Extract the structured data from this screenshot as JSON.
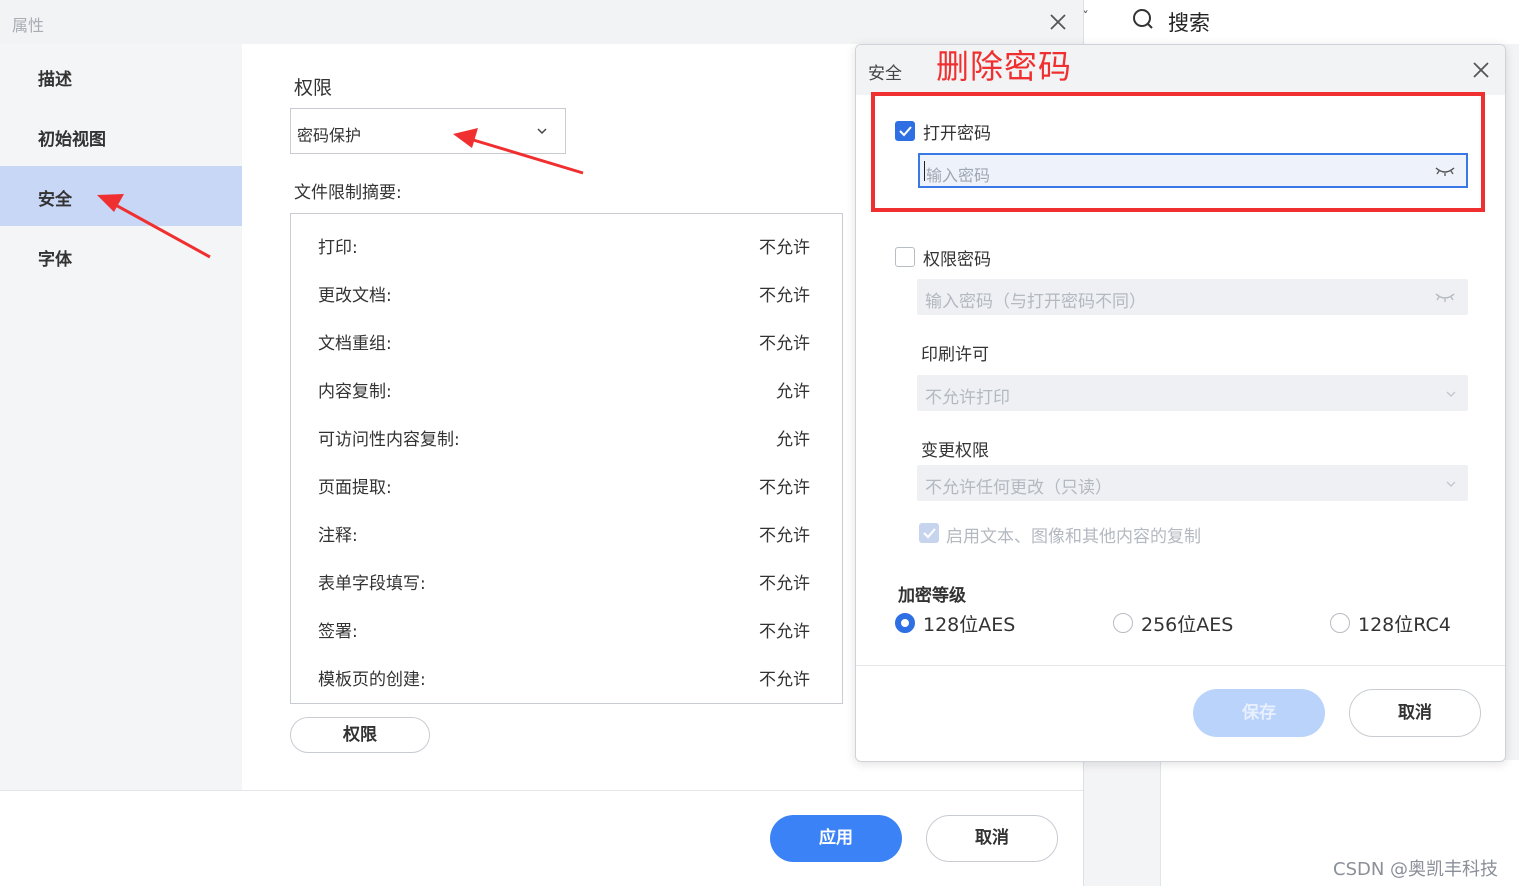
{
  "background_app": {
    "search_label": "搜索"
  },
  "properties_dialog": {
    "title": "属性",
    "sidebar": [
      {
        "label": "描述",
        "active": false
      },
      {
        "label": "初始视图",
        "active": false
      },
      {
        "label": "安全",
        "active": true
      },
      {
        "label": "字体",
        "active": false
      }
    ],
    "permission_heading": "权限",
    "permission_select_value": "密码保护",
    "summary_label": "文件限制摘要:",
    "summary_rows": [
      {
        "key": "打印:",
        "value": "不允许"
      },
      {
        "key": "更改文档:",
        "value": "不允许"
      },
      {
        "key": "文档重组:",
        "value": "不允许"
      },
      {
        "key": "内容复制:",
        "value": "允许"
      },
      {
        "key": "可访问性内容复制:",
        "value": "允许"
      },
      {
        "key": "页面提取:",
        "value": "不允许"
      },
      {
        "key": "注释:",
        "value": "不允许"
      },
      {
        "key": "表单字段填写:",
        "value": "不允许"
      },
      {
        "key": "签署:",
        "value": "不允许"
      },
      {
        "key": "模板页的创建:",
        "value": "不允许"
      }
    ],
    "permissions_button": "权限",
    "apply_button": "应用",
    "cancel_button": "取消"
  },
  "security_dialog": {
    "title": "安全",
    "open_password": {
      "label": "打开密码",
      "checked": true,
      "placeholder": "输入密码"
    },
    "permission_password": {
      "label": "权限密码",
      "checked": false,
      "placeholder": "输入密码（与打开密码不同）"
    },
    "print_label": "印刷许可",
    "print_value": "不允许打印",
    "change_label": "变更权限",
    "change_value": "不允许任何更改（只读）",
    "copy_label": "启用文本、图像和其他内容的复制",
    "copy_checked": true,
    "encryption_label": "加密等级",
    "encryption_options": [
      {
        "label": "128位AES",
        "selected": true
      },
      {
        "label": "256位AES",
        "selected": false
      },
      {
        "label": "128位RC4",
        "selected": false
      }
    ],
    "save_button": "保存",
    "cancel_button": "取消"
  },
  "annotation": {
    "text": "删除密码",
    "color": "#f03030"
  },
  "watermark": "CSDN @奥凯丰科技",
  "colors": {
    "accent": "#3b82f6",
    "sidebar_active": "#c9d7f7",
    "annotation_red": "#f03030"
  }
}
